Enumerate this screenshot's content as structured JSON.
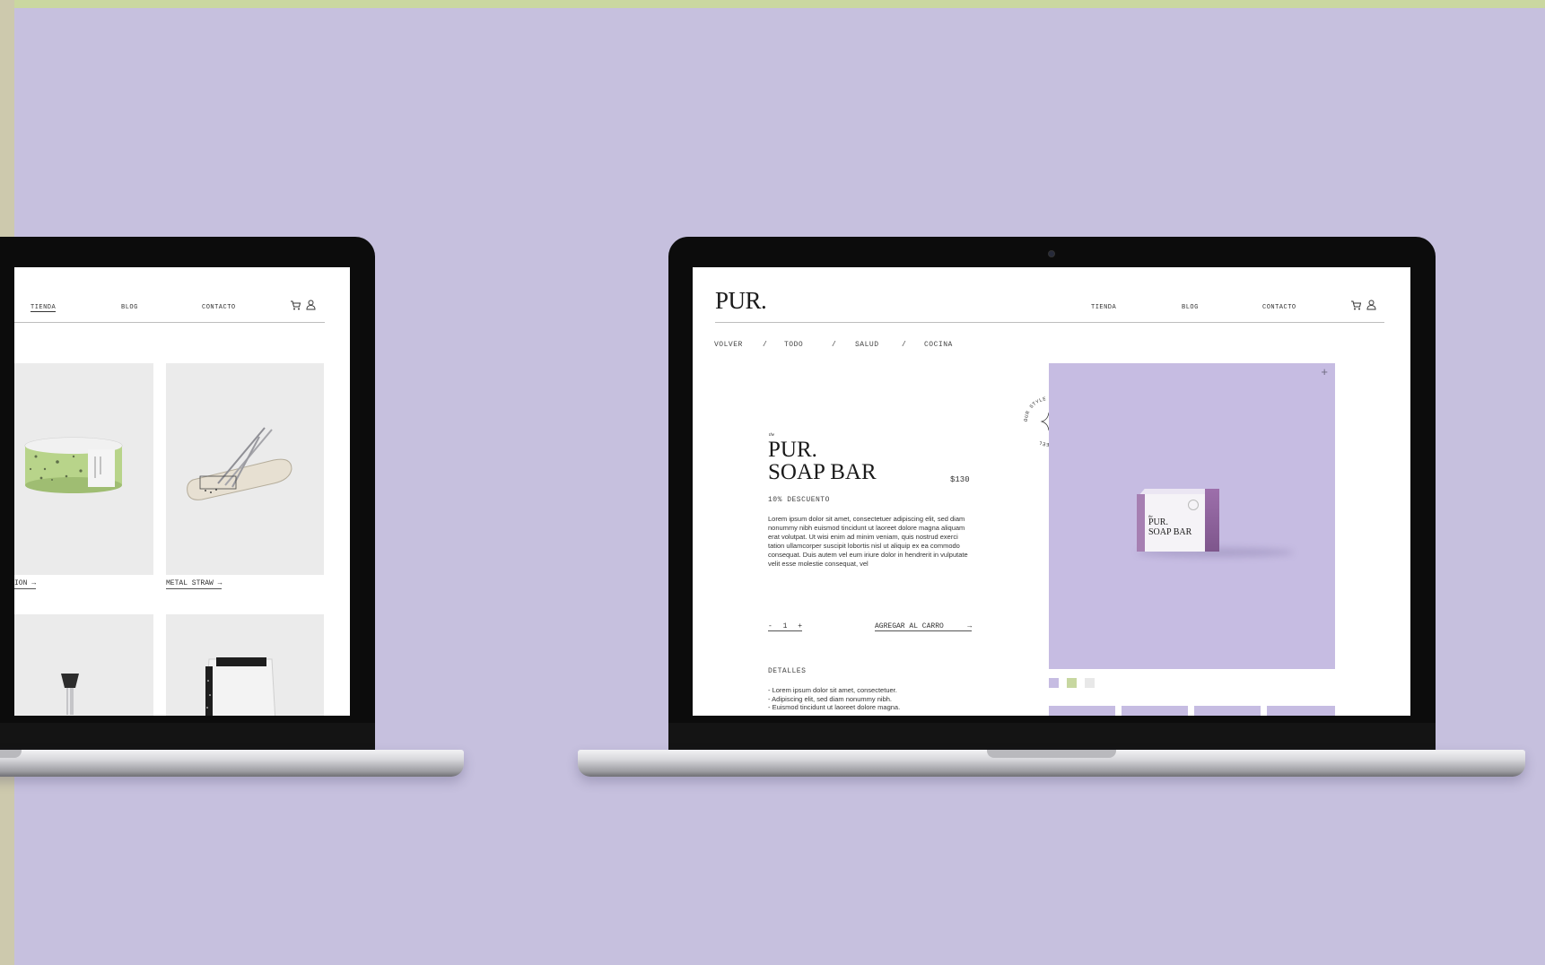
{
  "colors": {
    "background": "#c6c0de",
    "accent_strip_top": "#cad7a0",
    "accent_strip_left": "#cdc9ad",
    "product_lavender": "#c6bce2",
    "swatch_green": "#c7d7a0",
    "swatch_light": "#e8e8e8"
  },
  "left_laptop": {
    "nav": {
      "tienda": "TIENDA",
      "blog": "BLOG",
      "contacto": "CONTACTO"
    },
    "icons": [
      "cart-icon",
      "user-icon"
    ],
    "products": [
      {
        "label": "ION"
      },
      {
        "label": "METAL STRAW"
      }
    ],
    "arrow": "→"
  },
  "right_laptop": {
    "logo": "PUR.",
    "nav": {
      "tienda": "TIENDA",
      "blog": "BLOG",
      "contacto": "CONTACTO"
    },
    "icons": [
      "cart-icon",
      "user-icon"
    ],
    "breadcrumb": {
      "back": "VOLVER",
      "sep": "/",
      "todo": "TODO",
      "salud": "SALUD",
      "cocina": "COCINA"
    },
    "product": {
      "title_small": "the",
      "title_line1": "PUR.",
      "title_line2": "SOAP BAR",
      "price": "$130",
      "discount": "10% DESCUENTO",
      "description": "Lorem ipsum dolor sit amet, consectetuer adipiscing elit, sed diam nonummy nibh euismod tincidunt ut laoreet dolore magna aliquam erat volutpat. Ut wisi enim ad minim veniam, quis nostrud exerci tation ullamcorper suscipit lobortis nisl ut aliquip ex ea commodo consequat. Duis autem vel eum iriure dolor in hendrerit in vulputate velit esse molestie consequat, vel",
      "qty_minus": "-",
      "qty_value": "1",
      "qty_plus": "+",
      "add_to_cart": "AGREGAR AL CARRO",
      "arrow": "→",
      "details_heading": "DETALLES",
      "details": [
        "Lorem ipsum dolor sit amet, consectetuer.",
        "Adipiscing elit, sed diam nonummy nibh.",
        "Euismod tincidunt ut laoreet dolore magna."
      ],
      "stamp_text": "OUR STYLE OF LIFE · TO BE & FEEL",
      "box_label_small": "the",
      "box_label_line1": "PUR.",
      "box_label_line2": "SOAP BAR",
      "zoom_symbol": "+"
    }
  }
}
